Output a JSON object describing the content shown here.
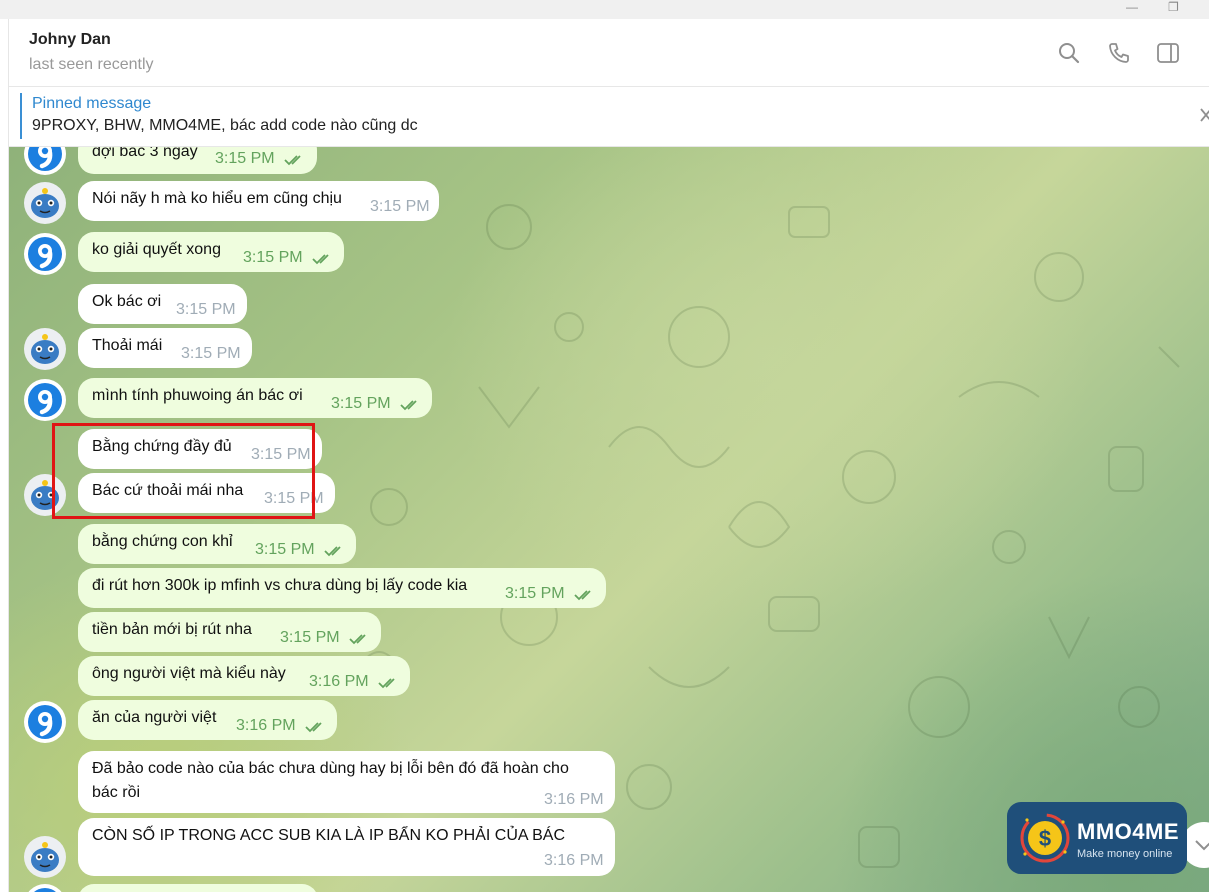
{
  "window": {
    "minimize_glyph": "—",
    "restore_glyph": "❐"
  },
  "header": {
    "contact_name": "Johny Dan",
    "status": "last seen recently",
    "icons": [
      "search-icon",
      "phone-icon",
      "sidebar-toggle-icon"
    ]
  },
  "pinned": {
    "title": "Pinned message",
    "text": "9PROXY, BHW, MMO4ME, bác add code nào cũng dc"
  },
  "messages": [
    {
      "text": "đợi bác 3 ngày",
      "time": "3:15 PM",
      "out": true
    },
    {
      "text": "Nói nãy h mà ko hiểu em cũng chịu",
      "time": "3:15 PM",
      "out": false
    },
    {
      "text": "ko giải quyết xong",
      "time": "3:15 PM",
      "out": true
    },
    {
      "text": "Ok bác ơi",
      "time": "3:15 PM",
      "out": false
    },
    {
      "text": "Thoải mái",
      "time": "3:15 PM",
      "out": false
    },
    {
      "text": "mình tính phuwoing án bác ơi",
      "time": "3:15 PM",
      "out": true
    },
    {
      "text": "Bằng chứng đầy đủ",
      "time": "3:15 PM",
      "out": false
    },
    {
      "text": "Bác cứ thoải mái nha",
      "time": "3:15 PM",
      "out": false
    },
    {
      "text": "bằng chứng con khỉ",
      "time": "3:15 PM",
      "out": true
    },
    {
      "text": "đi rút hơn  300k ip mfinh vs chưa dùng bị lấy code kia",
      "time": "3:15 PM",
      "out": true
    },
    {
      "text": "tiền bản mới bị rút nha",
      "time": "3:15 PM",
      "out": true
    },
    {
      "text": "ông người việt mà kiểu này",
      "time": "3:16 PM",
      "out": true
    },
    {
      "text": "ăn của người việt",
      "time": "3:16 PM",
      "out": true
    },
    {
      "text": "Đã bảo code nào của bác chưa dùng hay bị lỗi bên đó đã hoàn cho",
      "text2": "bác rồi",
      "time": "3:16 PM",
      "out": false
    },
    {
      "text": "CÒN SỐ IP TRONG ACC SUB KIA LÀ IP BẨN KO PHẢI CỦA BÁC",
      "time": "3:16 PM",
      "out": false
    }
  ],
  "watermark": {
    "name": "MMO4ME",
    "tagline": "Make money online",
    "colors": {
      "bg": "#1f4f7a",
      "accent": "#f5c518",
      "ring": "#e2463b"
    }
  },
  "colors": {
    "outgoing_bubble": "#effdde",
    "incoming_bubble": "#ffffff",
    "outgoing_time": "#63a35d",
    "incoming_time": "#a0acb6",
    "accent": "#2f88cf",
    "highlight": "#e01414"
  }
}
